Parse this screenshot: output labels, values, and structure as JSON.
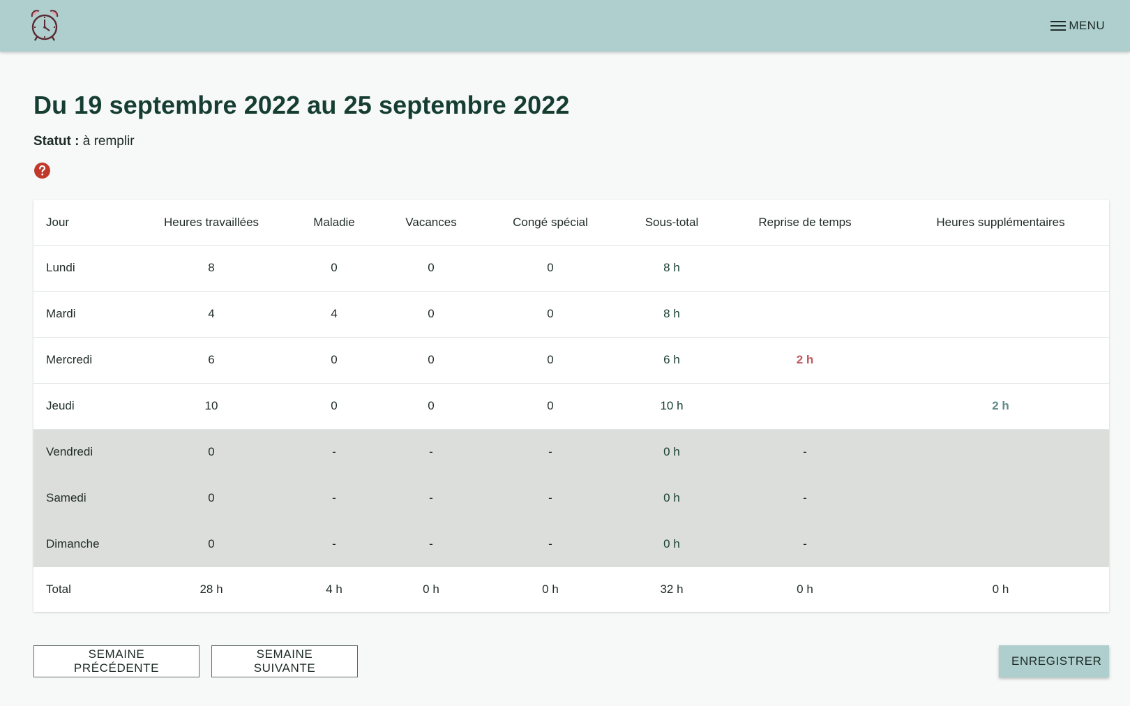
{
  "header": {
    "logo_icon": "alarm-clock-icon",
    "menu_icon": "hamburger-icon",
    "menu_label": "MENU",
    "background_color": "#aecfce"
  },
  "page": {
    "title": "Du 19 septembre 2022 au 25 septembre 2022",
    "status_label": "Statut :",
    "status_value": "à remplir",
    "help_icon": "help-icon",
    "help_color": "#c0392b"
  },
  "table": {
    "columns": [
      "Jour",
      "Heures travaillées",
      "Maladie",
      "Vacances",
      "Congé spécial",
      "Sous-total",
      "Reprise de temps",
      "Heures supplémentaires"
    ],
    "rows": [
      {
        "day": "Lundi",
        "worked": "8",
        "sick": "0",
        "vacation": "0",
        "special": "0",
        "subtotal": "8 h",
        "reprise": "",
        "overtime": ""
      },
      {
        "day": "Mardi",
        "worked": "4",
        "sick": "4",
        "vacation": "0",
        "special": "0",
        "subtotal": "8 h",
        "reprise": "",
        "overtime": ""
      },
      {
        "day": "Mercredi",
        "worked": "6",
        "sick": "0",
        "vacation": "0",
        "special": "0",
        "subtotal": "6 h",
        "reprise": "2 h",
        "overtime": ""
      },
      {
        "day": "Jeudi",
        "worked": "10",
        "sick": "0",
        "vacation": "0",
        "special": "0",
        "subtotal": "10 h",
        "reprise": "",
        "overtime": "2 h"
      },
      {
        "day": "Vendredi",
        "worked": "0",
        "sick": "-",
        "vacation": "-",
        "special": "-",
        "subtotal": "0 h",
        "reprise": "-",
        "overtime": ""
      },
      {
        "day": "Samedi",
        "worked": "0",
        "sick": "-",
        "vacation": "-",
        "special": "-",
        "subtotal": "0 h",
        "reprise": "-",
        "overtime": ""
      },
      {
        "day": "Dimanche",
        "worked": "0",
        "sick": "-",
        "vacation": "-",
        "special": "-",
        "subtotal": "0 h",
        "reprise": "-",
        "overtime": ""
      }
    ],
    "total": {
      "label": "Total",
      "worked": "28 h",
      "sick": "4 h",
      "vacation": "0 h",
      "special": "0 h",
      "subtotal": "32 h",
      "reprise": "0 h",
      "overtime": "0 h"
    },
    "colors": {
      "reprise": "#c0575c",
      "overtime": "#5e8a88",
      "weekend_row": "#dcdedc"
    }
  },
  "actions": {
    "previous_week": "SEMAINE PRÉCÉDENTE",
    "next_week": "SEMAINE SUIVANTE",
    "save": "ENREGISTRER"
  }
}
